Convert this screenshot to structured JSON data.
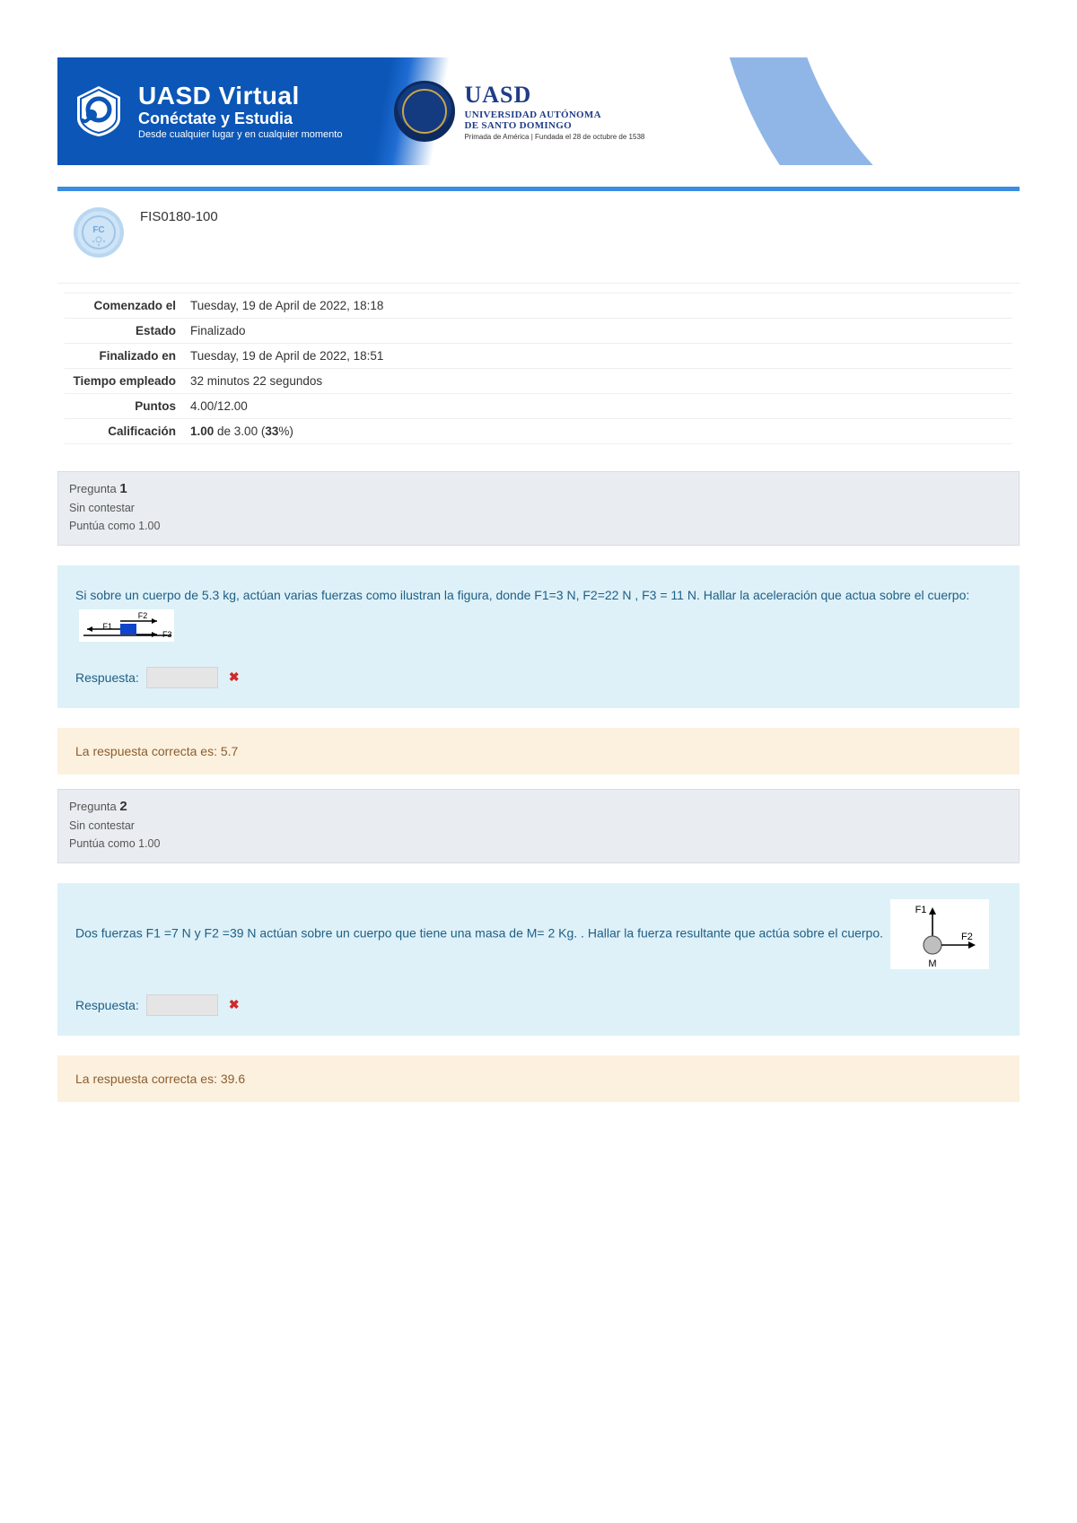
{
  "banner": {
    "brand_line1_a": "UASD",
    "brand_line1_b": "Virtual",
    "brand_line2": "Conéctate y Estudia",
    "brand_line3": "Desde cualquier lugar y en cualquier momento",
    "uasd_line1": "UASD",
    "uasd_line2": "UNIVERSIDAD AUTÓNOMA",
    "uasd_line3": "DE SANTO DOMINGO",
    "uasd_line4": "Primada de América | Fundada el 28 de octubre de 1538"
  },
  "course": {
    "code": "FIS0180-100"
  },
  "summary": {
    "rows": [
      {
        "label": "Comenzado el",
        "value_plain": "Tuesday, 19 de April de 2022, 18:18"
      },
      {
        "label": "Estado",
        "value_plain": "Finalizado"
      },
      {
        "label": "Finalizado en",
        "value_plain": "Tuesday, 19 de April de 2022, 18:51"
      },
      {
        "label": "Tiempo empleado",
        "value_plain": "32 minutos 22 segundos"
      },
      {
        "label": "Puntos",
        "value_plain": "4.00/12.00"
      },
      {
        "label": "Calificación",
        "value_rich": {
          "pre": "",
          "bold1": "1.00",
          "mid": " de 3.00 (",
          "bold2": "33",
          "post": "%)"
        }
      }
    ]
  },
  "questions": [
    {
      "label_word": "Pregunta",
      "number": "1",
      "status": "Sin contestar",
      "marks": "Puntúa como 1.00",
      "text_a": "Si sobre un cuerpo de 5.3 kg, actúan varias fuerzas como ilustran la figura, donde F1=3 N, F2=22 N , F3 = 11 N. Hallar la aceleración que actua sobre el cuerpo:",
      "figure_labels": {
        "F1": "F1",
        "F2": "F2",
        "F3": "F3"
      },
      "answer_label": "Respuesta:",
      "answer_value": "",
      "feedback": "La respuesta correcta es: 5.7"
    },
    {
      "label_word": "Pregunta",
      "number": "2",
      "status": "Sin contestar",
      "marks": "Puntúa como 1.00",
      "text_a": "Dos fuerzas  F1 =7 N  y F2 =39 N actúan sobre un cuerpo que tiene una masa de M= 2 Kg. . Hallar la fuerza resultante que actúa sobre el cuerpo.",
      "figure_labels": {
        "F1": "F1",
        "F2": "F2",
        "M": "M"
      },
      "answer_label": "Respuesta:",
      "answer_value": "",
      "feedback": "La respuesta correcta es: 39.6"
    }
  ]
}
